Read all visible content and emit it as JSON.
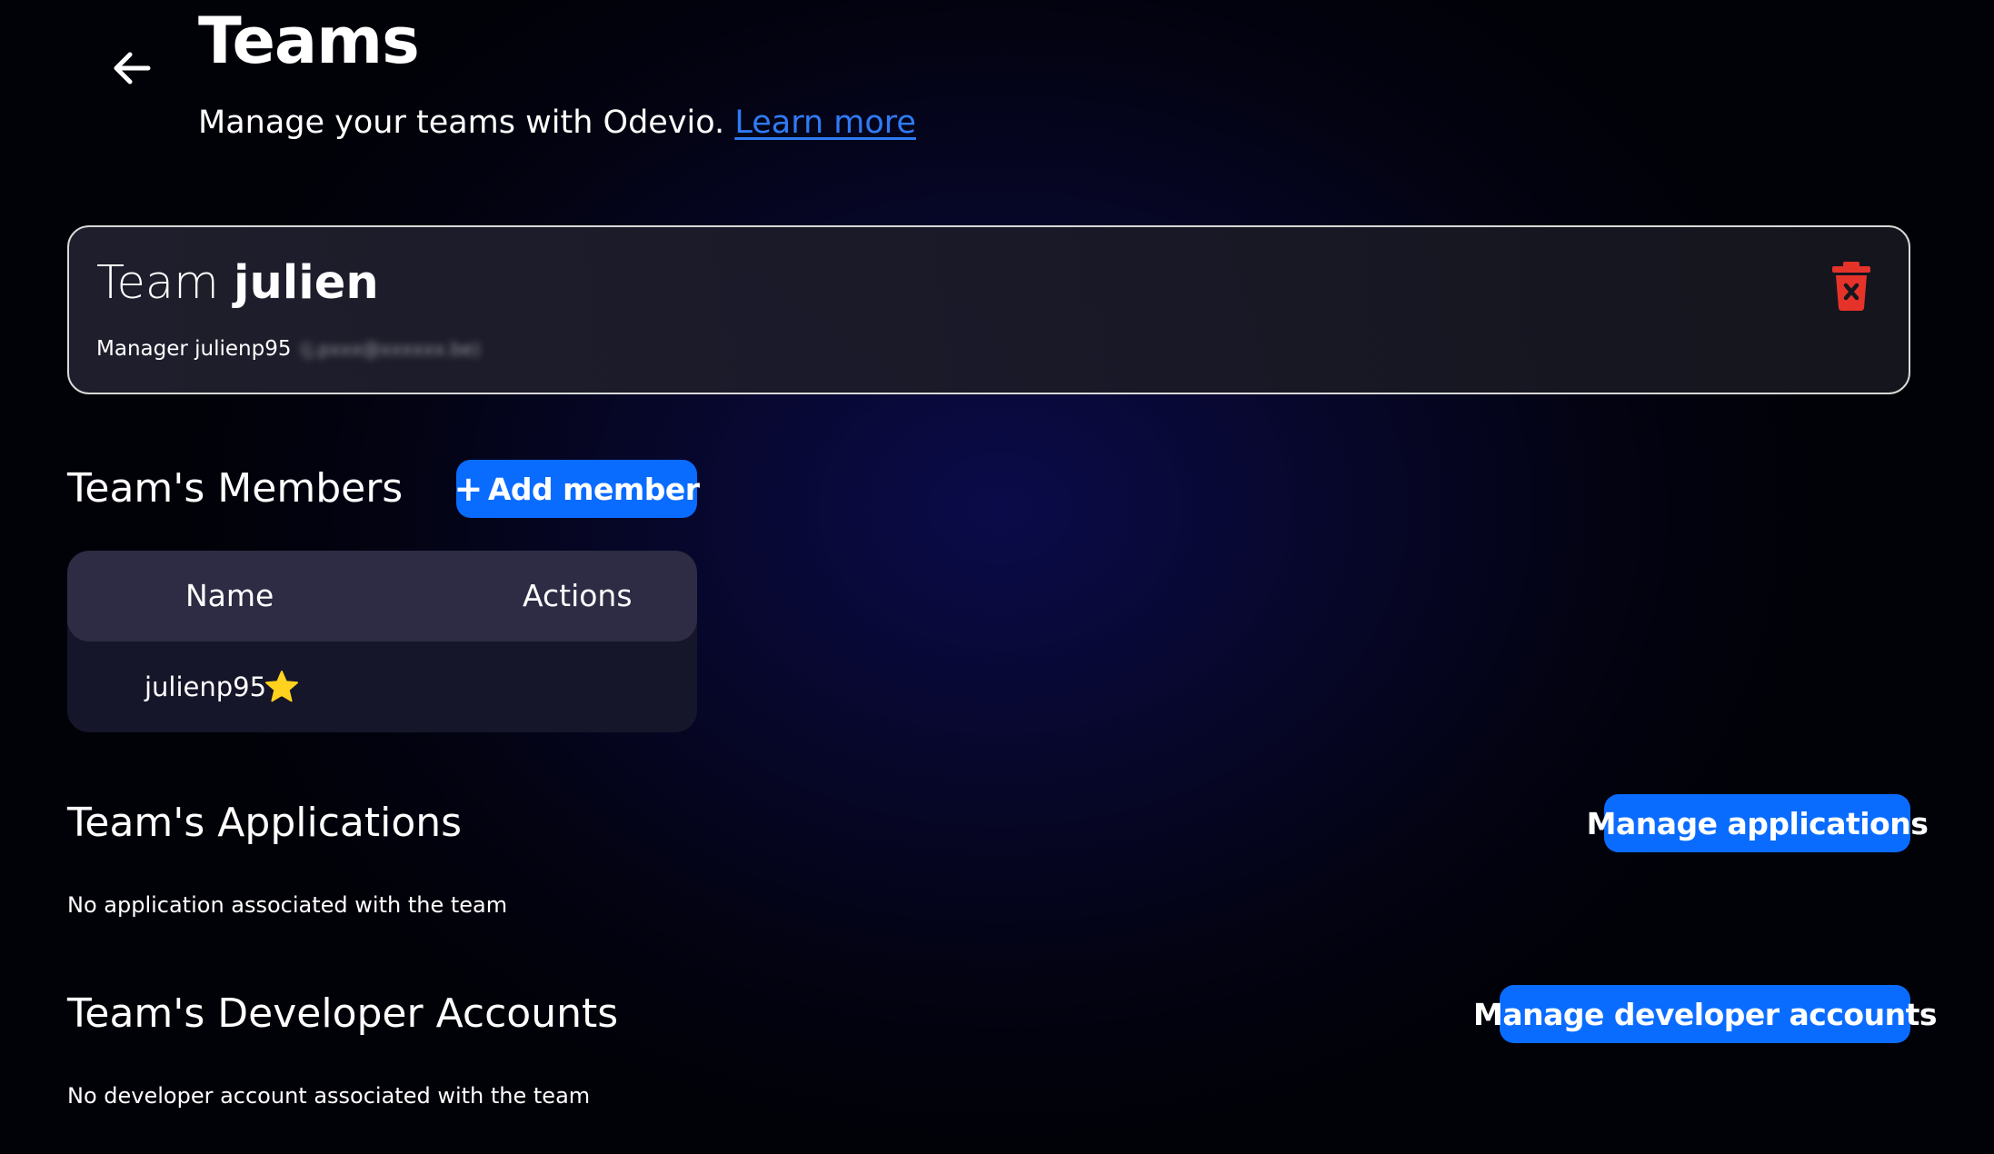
{
  "header": {
    "title": "Teams",
    "subtitle": "Manage your teams with Odevio.",
    "learn_more": "Learn more"
  },
  "team_card": {
    "prefix": "Team",
    "name": "julien",
    "manager_label": "Manager julienp95",
    "manager_email": "(j.pxxx@xxxxxx.be)"
  },
  "members": {
    "title": "Team's Members",
    "add_button": "Add member",
    "columns": [
      "Name",
      "Actions"
    ],
    "rows": [
      {
        "name": "julienp95",
        "is_manager": true
      }
    ]
  },
  "applications": {
    "title": "Team's Applications",
    "button": "Manage applications",
    "empty": "No application associated with the team"
  },
  "developer_accounts": {
    "title": "Team's Developer Accounts",
    "button": "Manage developer accounts",
    "empty": "No developer account associated with the team"
  },
  "icons": {
    "back": "arrow-left-icon",
    "delete": "trash-icon",
    "manager": "star-icon"
  },
  "colors": {
    "accent": "#0a6cff",
    "link": "#2f7bf5",
    "danger": "#e5332a",
    "star": "#ffd21f"
  }
}
